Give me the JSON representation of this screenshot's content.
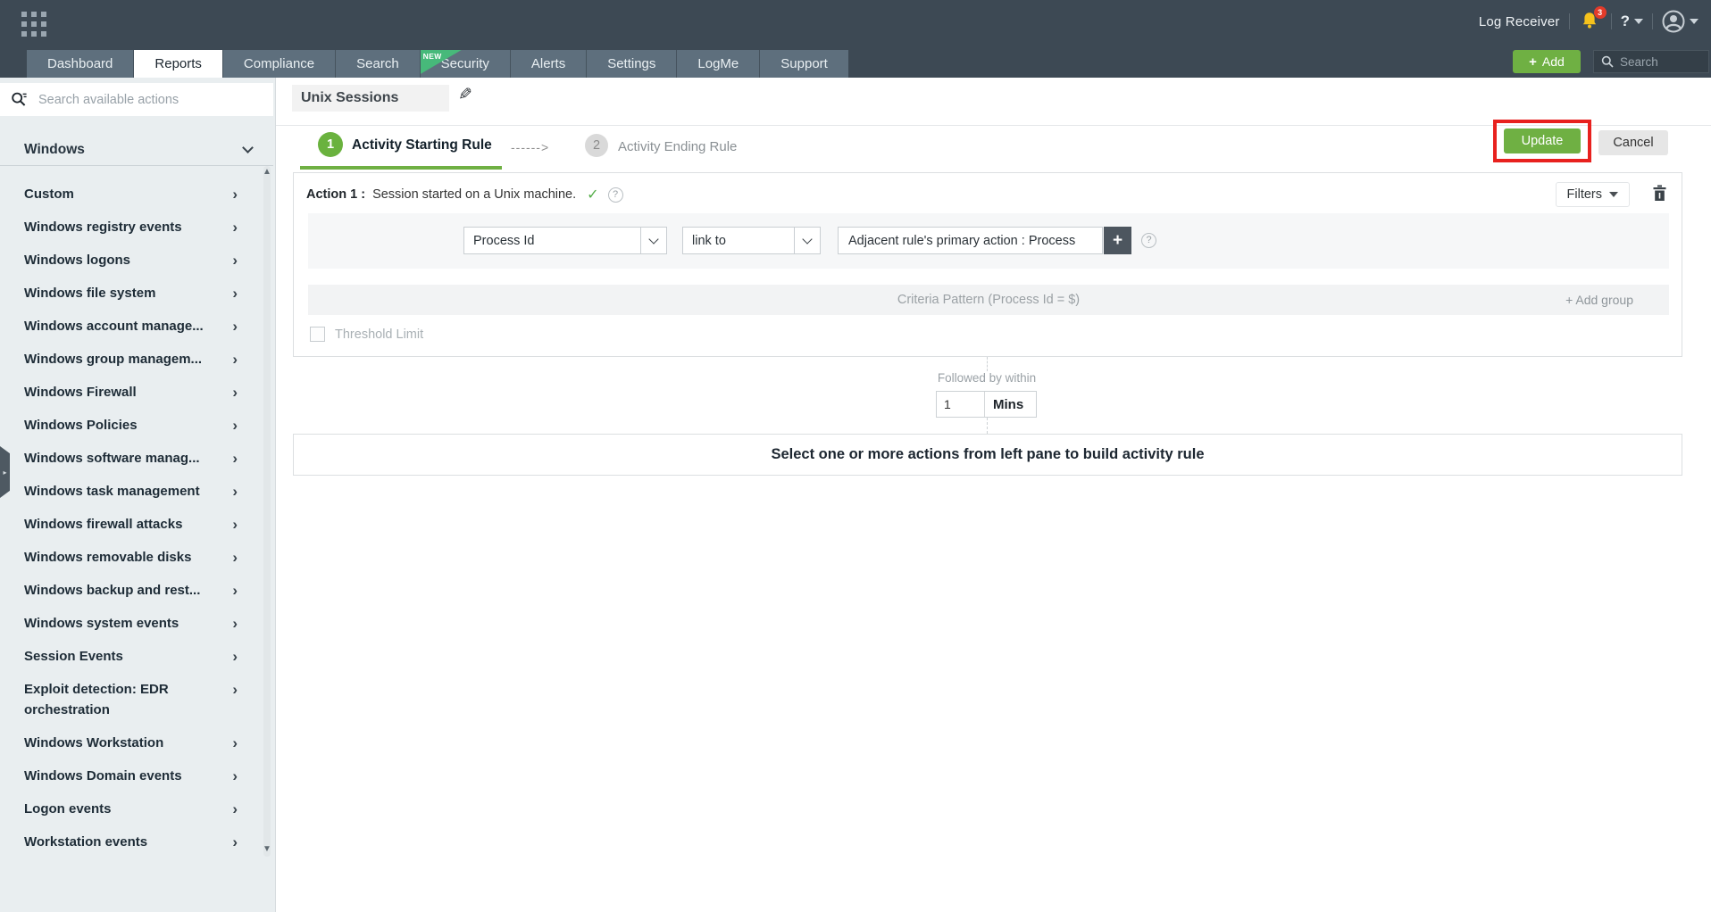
{
  "colors": {
    "topbar": "#3d4954",
    "accent_green": "#6fb043",
    "ribbon_green": "#47b97a",
    "annotation_red": "#e8211e",
    "notification_red": "#e23b2a",
    "bell_yellow": "#f6c21c",
    "sidebar_bg": "#e9eef0"
  },
  "icons": {
    "chevron_right": "›",
    "scroll_up": "▲",
    "scroll_down": "▼",
    "collapse_arrow": "▸",
    "pencil": "✎",
    "check": "✓",
    "help": "?",
    "plus": "+",
    "dashed_arrow": "------>"
  },
  "header": {
    "product_label": "Log Receiver",
    "notification_count": "3",
    "help_label": "?",
    "add_button_label": "Add",
    "search_placeholder": "Search",
    "tabs": [
      {
        "label": "Dashboard"
      },
      {
        "label": "Reports",
        "active": true
      },
      {
        "label": "Compliance"
      },
      {
        "label": "Search"
      },
      {
        "label": "Security",
        "badge": "NEW"
      },
      {
        "label": "Alerts"
      },
      {
        "label": "Settings"
      },
      {
        "label": "LogMe"
      },
      {
        "label": "Support"
      }
    ]
  },
  "sidebar": {
    "search_placeholder": "Search available actions",
    "group_label": "Windows",
    "items": [
      "Custom",
      "Windows registry events",
      "Windows logons",
      "Windows file system",
      "Windows account manage...",
      "Windows group managem...",
      "Windows Firewall",
      "Windows Policies",
      "Windows software manag...",
      "Windows task management",
      "Windows firewall attacks",
      "Windows removable disks",
      "Windows backup and rest...",
      "Windows system events",
      "Session Events",
      "Exploit detection: EDR orchestration",
      "Windows Workstation",
      "Windows Domain events",
      "Logon events",
      "Workstation events"
    ]
  },
  "main": {
    "report_title": "Unix Sessions",
    "steps": [
      {
        "number": "1",
        "label": "Activity Starting Rule",
        "active": true
      },
      {
        "number": "2",
        "label": "Activity Ending Rule",
        "active": false
      }
    ],
    "update_button": "Update",
    "cancel_button": "Cancel",
    "rule_card": {
      "action_label": "Action 1 :",
      "action_text": "Session started on a Unix machine.",
      "filters_label": "Filters",
      "field_select_value": "Process Id",
      "operator_select_value": "link to",
      "value_field_text": "Adjacent rule's primary action : Process",
      "criteria_pattern": "Criteria Pattern (Process Id = $)",
      "add_group_label": "+ Add group",
      "threshold_label": "Threshold Limit"
    },
    "followed_by": {
      "label": "Followed by within",
      "value": "1",
      "unit": "Mins"
    },
    "empty_card_text": "Select one or more actions from left pane to build activity rule"
  }
}
